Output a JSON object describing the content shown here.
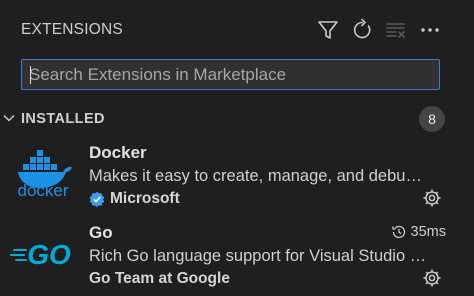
{
  "header": {
    "title": "EXTENSIONS",
    "icons": [
      "filter-icon",
      "refresh-icon",
      "clear-icon",
      "more-icon"
    ]
  },
  "search": {
    "placeholder": "Search Extensions in Marketplace",
    "value": ""
  },
  "section": {
    "label": "INSTALLED",
    "count": "8"
  },
  "extensions": [
    {
      "name": "Docker",
      "description": "Makes it easy to create, manage, and debu…",
      "publisher": "Microsoft",
      "verified": true,
      "icon": "docker-logo-icon",
      "icon_text": "docker"
    },
    {
      "name": "Go",
      "description": "Rich Go language support for Visual Studio …",
      "publisher": "Go Team at Google",
      "verified": false,
      "activation_time": "35ms",
      "icon": "go-logo-icon",
      "icon_text": "GO"
    }
  ],
  "colors": {
    "accent": "#3b7ed6",
    "docker": "#1d91e6",
    "go": "#00acd7",
    "background": "#1f1f1f"
  }
}
